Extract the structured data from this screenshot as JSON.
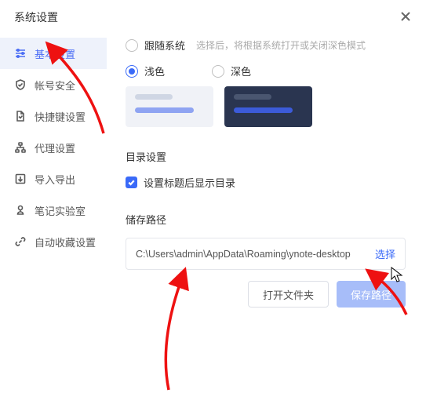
{
  "title": "系统设置",
  "sidebar": {
    "items": [
      {
        "label": "基本设置"
      },
      {
        "label": "帐号安全"
      },
      {
        "label": "快捷键设置"
      },
      {
        "label": "代理设置"
      },
      {
        "label": "导入导出"
      },
      {
        "label": "笔记实验室"
      },
      {
        "label": "自动收藏设置"
      }
    ]
  },
  "theme": {
    "follow_label": "跟随系统",
    "follow_hint": "选择后，将根据系统打开或关闭深色模式",
    "light_label": "浅色",
    "dark_label": "深色"
  },
  "directory": {
    "title": "目录设置",
    "checkbox_label": "设置标题后显示目录"
  },
  "storage": {
    "title": "储存路径",
    "path": "C:\\Users\\admin\\AppData\\Roaming\\ynote-desktop",
    "select_label": "选择",
    "open_button": "打开文件夹",
    "save_button": "保存路径"
  }
}
